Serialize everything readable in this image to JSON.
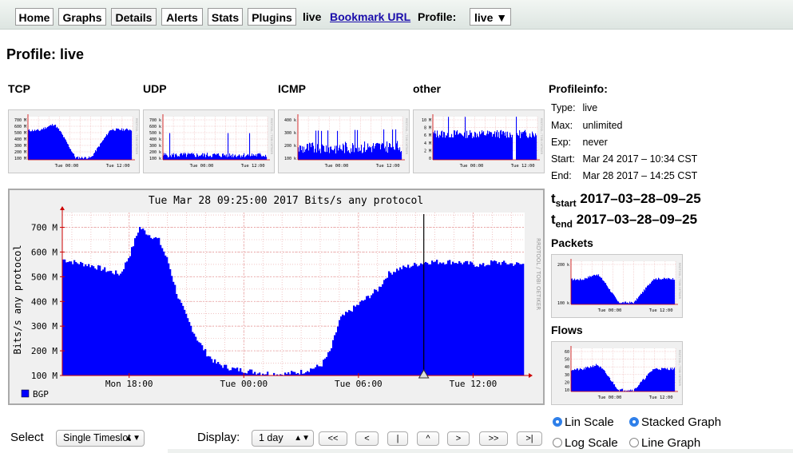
{
  "nav": {
    "tabs": [
      "Home",
      "Graphs",
      "Details",
      "Alerts",
      "Stats",
      "Plugins"
    ],
    "active_tab": "Details",
    "profile_name": "live",
    "bookmark_label": "Bookmark URL",
    "profile_label": "Profile:",
    "profile_value": "live ▼"
  },
  "page_title": "Profile: live",
  "small_graphs": [
    {
      "label": "TCP",
      "ticks": [
        "700 M",
        "600 M",
        "500 M",
        "400 M",
        "300 M",
        "200 M",
        "100 M"
      ],
      "x_ticks": [
        "Tue 00:00",
        "Tue 12:00"
      ]
    },
    {
      "label": "UDP",
      "ticks": [
        "700 k",
        "600 k",
        "500 k",
        "400 k",
        "300 k",
        "200 k",
        "100 k"
      ],
      "x_ticks": [
        "Tue 00:00",
        "Tue 12:00"
      ]
    },
    {
      "label": "ICMP",
      "ticks": [
        "400 k",
        "300 k",
        "200 k",
        "100 k"
      ],
      "x_ticks": [
        "Tue 00:00",
        "Tue 12:00"
      ]
    },
    {
      "label": "other",
      "ticks": [
        "10 M",
        "8 M",
        "6 M",
        "4 M",
        "2 M",
        "0"
      ],
      "x_ticks": [
        "Tue 00:00",
        "Tue 12:00"
      ]
    }
  ],
  "profile_info": {
    "title": "Profileinfo:",
    "rows": [
      {
        "k": "Type:",
        "v": "live"
      },
      {
        "k": "Max:",
        "v": "unlimited"
      },
      {
        "k": "Exp:",
        "v": "never"
      },
      {
        "k": "Start:",
        "v": "Mar 24 2017 – 10:34 CST"
      },
      {
        "k": "End:",
        "v": "Mar 28 2017 – 14:25 CST"
      }
    ],
    "t_start_base": "t",
    "t_start_sub": "start",
    "t_start_value": "2017–03–28–09–25",
    "t_end_base": "t",
    "t_end_sub": "end",
    "t_end_value": "2017–03–28–09–25"
  },
  "side_graphs": {
    "packets_label": "Packets",
    "packets_ticks": [
      "200 k",
      "100 k"
    ],
    "flows_label": "Flows",
    "flows_ticks": [
      "60",
      "50",
      "40",
      "30",
      "20",
      "10"
    ],
    "x_ticks": [
      "Tue 00:00",
      "Tue 12:00"
    ]
  },
  "main_graph": {
    "title": "Tue Mar 28 09:25:00 2017 Bits/s any protocol",
    "ylabel": "Bits/s any protocol",
    "side_text": "RRDTOOL / TOBI OETIKER",
    "legend": "BGP",
    "colors": {
      "fill": "#0000ff",
      "grid": "#e7a0a0",
      "axis": "#cc0000"
    }
  },
  "chart_data": {
    "type": "area",
    "title": "Tue Mar 28 09:25:00 2017 Bits/s any protocol",
    "ylabel": "Bits/s any protocol",
    "y_unit": "M",
    "y_ticks": [
      100,
      200,
      300,
      400,
      500,
      600,
      700
    ],
    "ylim": [
      100,
      760
    ],
    "x_ticks": [
      "Mon 18:00",
      "Tue 00:00",
      "Tue 06:00",
      "Tue 12:00"
    ],
    "x_hours": [
      -9.5,
      -9,
      -8,
      -7,
      -6.5,
      -6,
      -5.5,
      -5,
      -4.5,
      -4,
      -3.5,
      -3,
      -2.5,
      -2,
      -1.5,
      -1,
      -0.5,
      0,
      1,
      2,
      3,
      4,
      4.5,
      5,
      5.5,
      6,
      6.5,
      7,
      7.5,
      8,
      8.5,
      9,
      9.5,
      10,
      11,
      12,
      12.5,
      13,
      13.5,
      14.5
    ],
    "series": [
      {
        "name": "BGP",
        "values": [
          570,
          560,
          545,
          520,
          510,
          590,
          700,
          670,
          650,
          560,
          420,
          330,
          250,
          190,
          150,
          135,
          125,
          120,
          110,
          105,
          115,
          140,
          200,
          330,
          360,
          390,
          420,
          450,
          510,
          530,
          540,
          550,
          560,
          560,
          560,
          550,
          545,
          560,
          555,
          550
        ]
      }
    ],
    "cursor_hour": 9.42,
    "legend": "top-left"
  },
  "controls": {
    "select_label": "Select",
    "select_value": "Single Timeslot",
    "display_label": "Display:",
    "display_value": "1 day",
    "nav_buttons": [
      "<<",
      "<",
      "|",
      "^",
      ">",
      ">>",
      ">|"
    ],
    "radios": [
      {
        "label": "Lin Scale",
        "checked": true
      },
      {
        "label": "Stacked Graph",
        "checked": true
      },
      {
        "label": "Log Scale",
        "checked": false
      },
      {
        "label": "Line Graph",
        "checked": false
      }
    ]
  }
}
